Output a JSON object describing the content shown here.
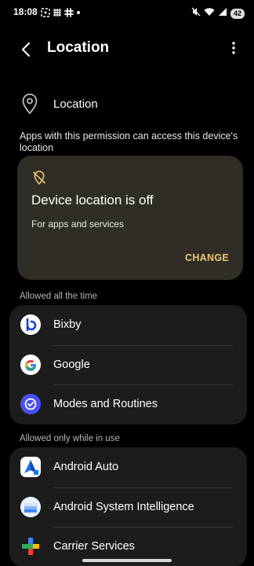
{
  "status_bar": {
    "time": "18:08",
    "battery_level": "42"
  },
  "header": {
    "title": "Location"
  },
  "master_switch": {
    "label": "Location"
  },
  "permission_description": "Apps with this permission can access this device's location",
  "location_off_card": {
    "title": "Device location is off",
    "subtitle": "For apps and services",
    "action_label": "CHANGE",
    "accent_color": "#e8c874"
  },
  "sections": [
    {
      "header": "Allowed all the time",
      "apps": [
        {
          "name": "Bixby",
          "icon": "bixby-icon"
        },
        {
          "name": "Google",
          "icon": "google-icon"
        },
        {
          "name": "Modes and Routines",
          "icon": "modes-routines-icon"
        }
      ]
    },
    {
      "header": "Allowed only while in use",
      "apps": [
        {
          "name": "Android Auto",
          "icon": "android-auto-icon"
        },
        {
          "name": "Android System Intelligence",
          "icon": "android-system-intelligence-icon"
        },
        {
          "name": "Carrier Services",
          "icon": "carrier-services-icon"
        }
      ]
    }
  ]
}
